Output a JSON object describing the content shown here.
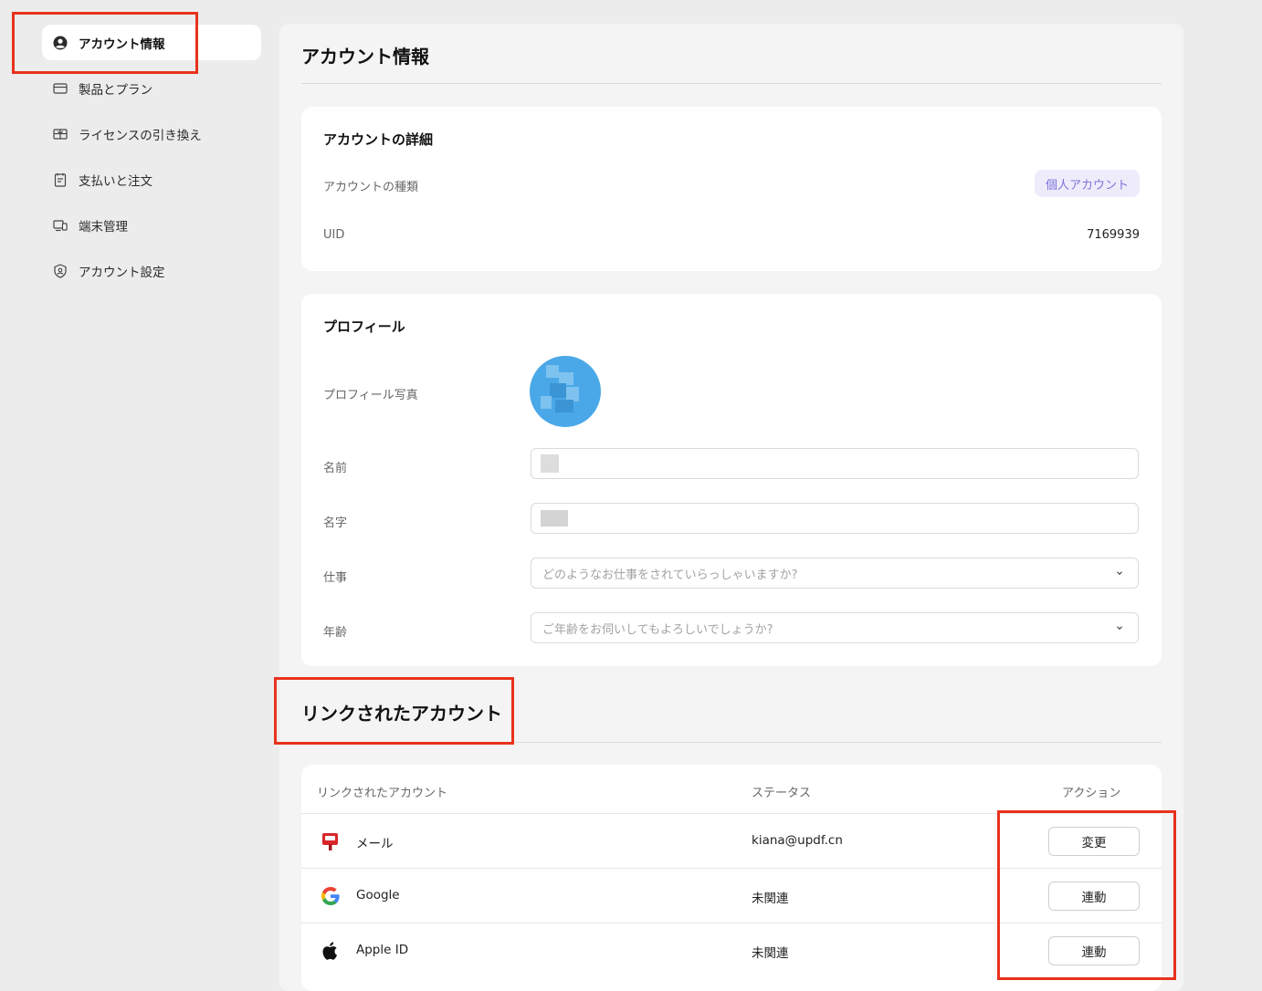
{
  "sidebar": {
    "items": [
      {
        "label": "アカウント情報",
        "icon": "user-circle-icon",
        "active": true
      },
      {
        "label": "製品とプラン",
        "icon": "card-icon",
        "active": false
      },
      {
        "label": "ライセンスの引き換え",
        "icon": "gift-icon",
        "active": false
      },
      {
        "label": "支払いと注文",
        "icon": "receipt-icon",
        "active": false
      },
      {
        "label": "端末管理",
        "icon": "devices-icon",
        "active": false
      },
      {
        "label": "アカウント設定",
        "icon": "shield-user-icon",
        "active": false
      }
    ]
  },
  "main": {
    "title": "アカウント情報",
    "details": {
      "title": "アカウントの詳細",
      "type_label": "アカウントの種類",
      "type_value": "個人アカウント",
      "uid_label": "UID",
      "uid_value": "7169939"
    },
    "profile": {
      "title": "プロフィール",
      "photo_label": "プロフィール写真",
      "first_name_label": "名前",
      "last_name_label": "名字",
      "job_label": "仕事",
      "job_placeholder": "どのようなお仕事をされていらっしゃいますか?",
      "age_label": "年齢",
      "age_placeholder": "ご年齢をお伺いしてもよろしいでしょうか?"
    },
    "linked": {
      "title": "リンクされたアカウント",
      "columns": [
        "リンクされたアカウント",
        "ステータス",
        "アクション"
      ],
      "rows": [
        {
          "name": "メール",
          "icon": "mail-icon",
          "status": "kiana@updf.cn",
          "action": "変更"
        },
        {
          "name": "Google",
          "icon": "google-icon",
          "status": "未関連",
          "action": "連動"
        },
        {
          "name": "Apple ID",
          "icon": "apple-icon",
          "status": "未関連",
          "action": "連動"
        }
      ]
    }
  },
  "colors": {
    "highlight_box": "#e8321c",
    "badge_bg": "#eeecfb",
    "badge_text": "#7a73d9"
  }
}
